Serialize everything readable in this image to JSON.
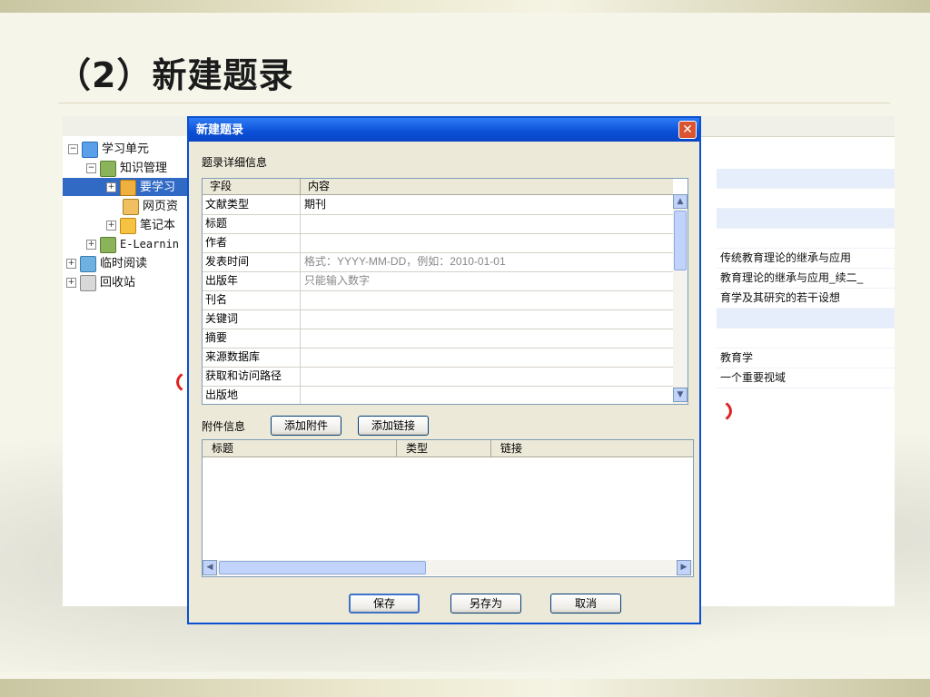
{
  "slide": {
    "title": "（2）新建题录"
  },
  "tree": {
    "items": [
      {
        "label": "学习单元",
        "expander": "−"
      },
      {
        "label": "知识管理",
        "expander": "−"
      },
      {
        "label": "要学习",
        "expander": "+"
      },
      {
        "label": "网页资",
        "expander": ""
      },
      {
        "label": "笔记本",
        "expander": "+"
      },
      {
        "label": "E-Learnin",
        "expander": "+"
      },
      {
        "label": "临时阅读",
        "expander": "+"
      },
      {
        "label": "回收站",
        "expander": "+"
      }
    ]
  },
  "right_list": {
    "rows": [
      "",
      "",
      "",
      "",
      "传统教育理论的继承与应用",
      "教育理论的继承与应用_续二_",
      "育学及其研究的若干设想",
      "",
      "",
      "教育学",
      "一个重要视域"
    ]
  },
  "dialog": {
    "title": "新建题录",
    "close_glyph": "✕",
    "detail_label": "题录详细信息",
    "columns": {
      "field": "字段",
      "content": "内容"
    },
    "rows": [
      {
        "field": "文献类型",
        "value": "期刊"
      },
      {
        "field": "标题",
        "value": ""
      },
      {
        "field": "作者",
        "value": ""
      },
      {
        "field": "发表时间",
        "value": "格式：YYYY-MM-DD，例如：2010-01-01"
      },
      {
        "field": "出版年",
        "value": "只能输入数字"
      },
      {
        "field": "刊名",
        "value": ""
      },
      {
        "field": "关键词",
        "value": ""
      },
      {
        "field": "摘要",
        "value": ""
      },
      {
        "field": "来源数据库",
        "value": ""
      },
      {
        "field": "获取和访问路径",
        "value": ""
      },
      {
        "field": "出版地",
        "value": ""
      }
    ],
    "attachments": {
      "label": "附件信息",
      "add_attachment": "添加附件",
      "add_link": "添加链接",
      "columns": [
        "标题",
        "类型",
        "链接"
      ]
    },
    "buttons": {
      "save": "保存",
      "save_as": "另存为",
      "cancel": "取消"
    }
  }
}
